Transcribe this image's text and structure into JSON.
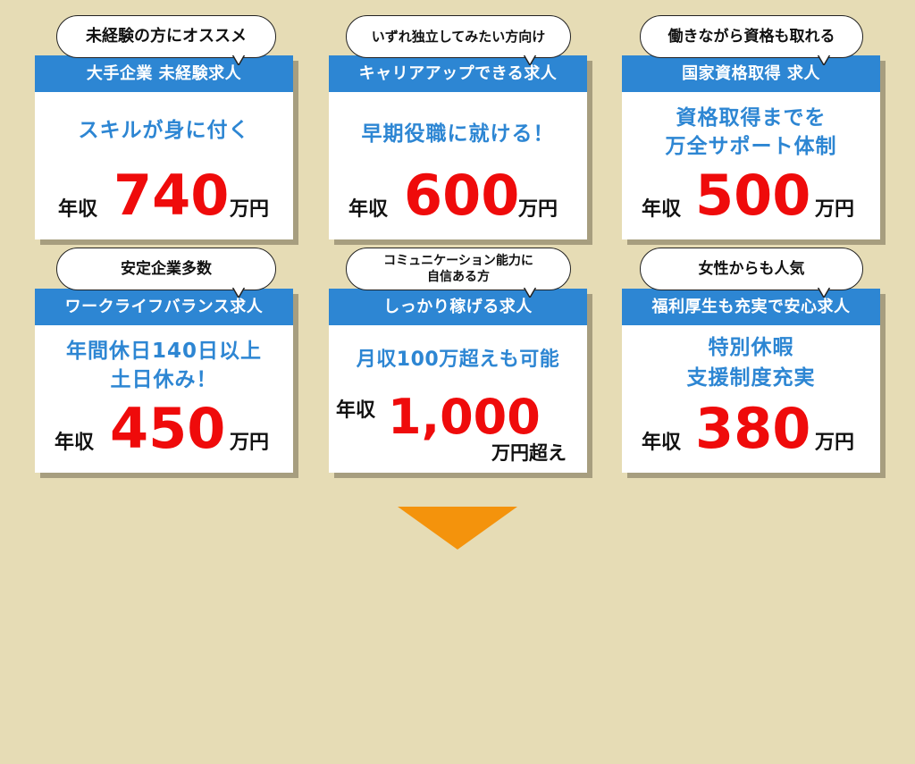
{
  "cards": [
    {
      "bubble": "未経験の方にオススメ",
      "header": "大手企業 未経験求人",
      "sub": [
        "スキルが身に付く"
      ],
      "label": "年収",
      "value": "740",
      "unit": "万円"
    },
    {
      "bubble": "いずれ独立してみたい方向け",
      "header": "キャリアアップできる求人",
      "sub": [
        "早期役職に就ける！"
      ],
      "label": "年収",
      "value": "600",
      "unit": "万円"
    },
    {
      "bubble": "働きながら資格も取れる",
      "header": "国家資格取得 求人",
      "sub": [
        "資格取得までを",
        "万全サポート体制"
      ],
      "label": "年収",
      "value": "500",
      "unit": "万円"
    },
    {
      "bubble": "安定企業多数",
      "header": "ワークライフバランス求人",
      "sub": [
        "年間休日140日以上",
        "土日休み！"
      ],
      "label": "年収",
      "value": "450",
      "unit": "万円"
    },
    {
      "bubble": "コミュニケーション能力に\n自信ある方",
      "header": "しっかり稼げる求人",
      "sub": [
        "月収100万超えも可能"
      ],
      "label": "年収",
      "value": "1,000",
      "unit": "万円超え"
    },
    {
      "bubble": "女性からも人気",
      "header": "福利厚生も充実で安心求人",
      "sub": [
        "特別休暇",
        "支援制度充実"
      ],
      "label": "年収",
      "value": "380",
      "unit": "万円"
    }
  ],
  "colors": {
    "background": "#e6dcb5",
    "header": "#2d86d3",
    "salary": "#ef0b0b",
    "arrow": "#f4930c"
  },
  "arrow_icon": "down-triangle-icon"
}
